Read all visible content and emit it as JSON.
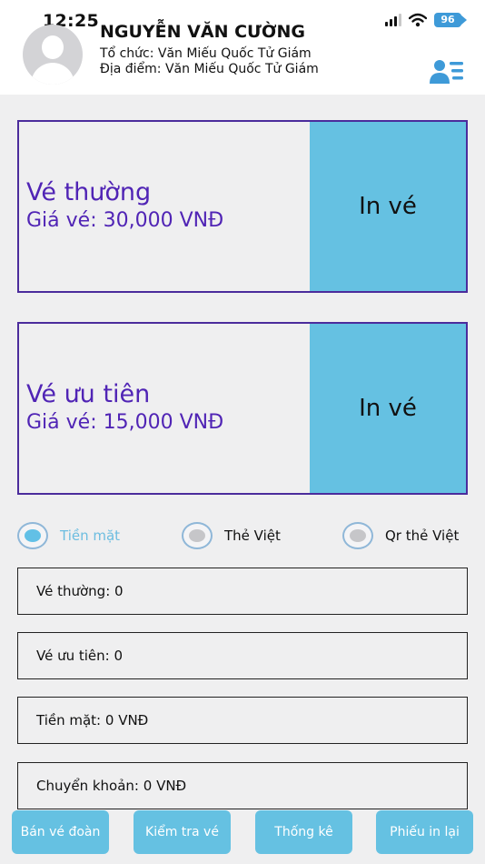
{
  "status_bar": {
    "time": "12:25",
    "battery": "96"
  },
  "user": {
    "name": "NGUYỄN VĂN CƯỜNG",
    "organization": "Tổ chức: Văn Miếu Quốc Tử Giám",
    "location": "Địa điểm: Văn Miếu Quốc Tử Giám"
  },
  "tickets": [
    {
      "name": "Vé thường",
      "price": "Giá vé: 30,000 VNĐ",
      "print_label": "In vé"
    },
    {
      "name": "Vé ưu tiên",
      "price": "Giá vé: 15,000 VNĐ",
      "print_label": "In vé"
    }
  ],
  "payment_methods": [
    {
      "label": "Tiền mặt",
      "selected": true
    },
    {
      "label": "Thẻ Việt",
      "selected": false
    },
    {
      "label": "Qr thẻ Việt",
      "selected": false
    }
  ],
  "summary": {
    "regular": "Vé thường: 0",
    "priority": "Vé ưu tiên: 0",
    "cash": "Tiền mặt: 0 VNĐ",
    "transfer": "Chuyển khoản: 0 VNĐ"
  },
  "bottom_nav": {
    "group_sale": "Bán vé đoàn",
    "check_ticket": "Kiểm tra vé",
    "statistics": "Thống kê",
    "print_receipt": "Phiếu in lại"
  },
  "colors": {
    "accent": "#65c1e2",
    "card_border": "#4b2c9c",
    "ticket_text": "#5024b5",
    "status_icon": "#3e9ad8"
  }
}
